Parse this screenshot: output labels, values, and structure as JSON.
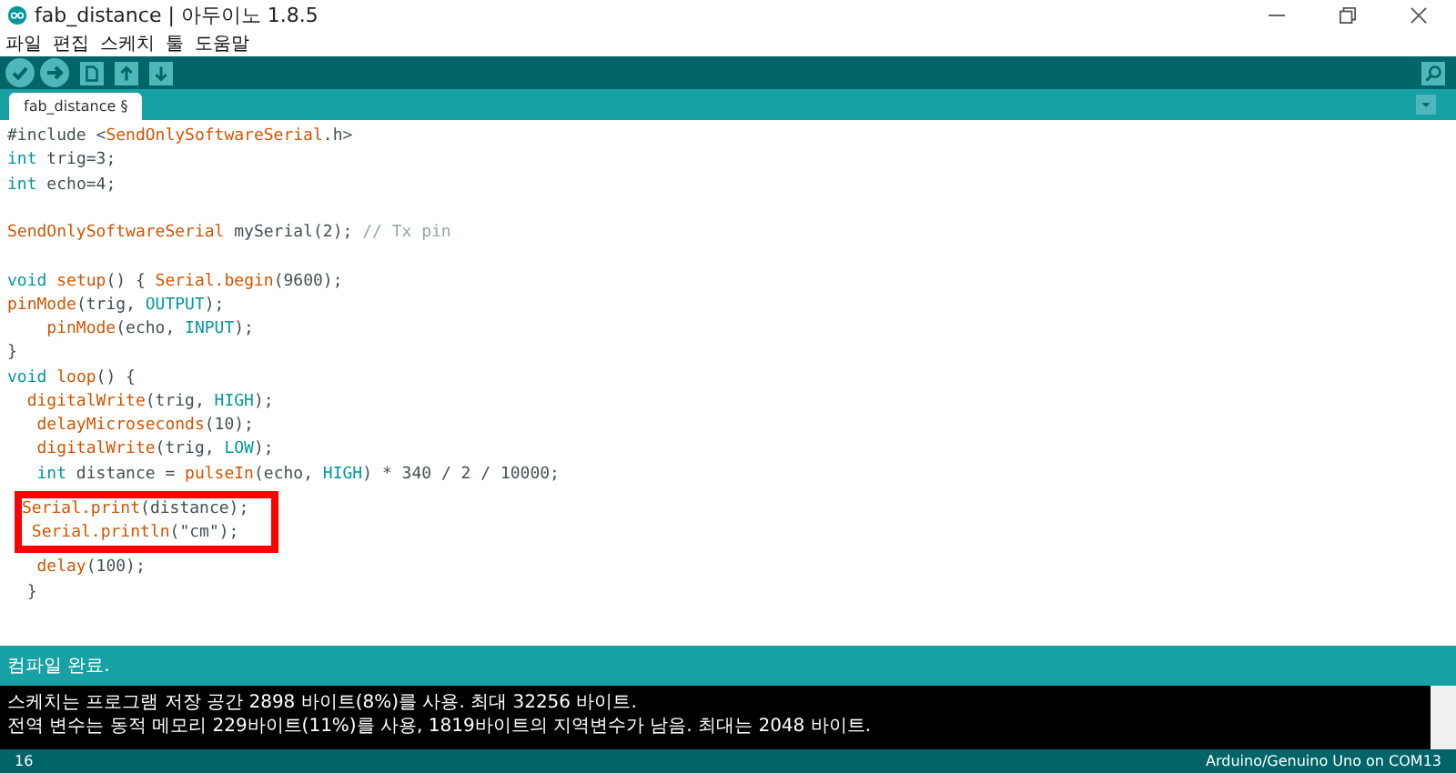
{
  "window": {
    "title": "fab_distance | 아두이노 1.8.5"
  },
  "menu": [
    "파일",
    "편집",
    "스케치",
    "툴",
    "도움말"
  ],
  "tabs": [
    {
      "label": "fab_distance §",
      "selected": true
    }
  ],
  "editor": {
    "lines": [
      {
        "kind": "code",
        "highlighted": false,
        "segments": [
          {
            "kind": "text",
            "s": "#include <"
          },
          {
            "kind": "fn",
            "s": "SendOnlySoftwareSerial"
          },
          {
            "kind": "text",
            "s": ".h>"
          }
        ]
      },
      {
        "kind": "code",
        "highlighted": false,
        "segments": [
          {
            "kind": "kw",
            "s": "int"
          },
          {
            "kind": "text",
            "s": " trig=3;"
          }
        ]
      },
      {
        "kind": "code",
        "highlighted": false,
        "segments": [
          {
            "kind": "kw",
            "s": "int"
          },
          {
            "kind": "text",
            "s": " echo=4;"
          }
        ]
      },
      {
        "kind": "blank"
      },
      {
        "kind": "code",
        "highlighted": false,
        "segments": [
          {
            "kind": "fn",
            "s": "SendOnlySoftwareSerial"
          },
          {
            "kind": "text",
            "s": " mySerial(2); "
          },
          {
            "kind": "comment",
            "s": "// Tx pin"
          }
        ]
      },
      {
        "kind": "blank"
      },
      {
        "kind": "code",
        "highlighted": false,
        "segments": [
          {
            "kind": "kw",
            "s": "void"
          },
          {
            "kind": "fn",
            "s": " setup"
          },
          {
            "kind": "text",
            "s": "() { "
          },
          {
            "kind": "fn",
            "s": "Serial.begin"
          },
          {
            "kind": "text",
            "s": "(9600);"
          }
        ]
      },
      {
        "kind": "code",
        "highlighted": false,
        "segments": [
          {
            "kind": "fn",
            "s": "pinMode"
          },
          {
            "kind": "text",
            "s": "(trig, "
          },
          {
            "kind": "kw",
            "s": "OUTPUT"
          },
          {
            "kind": "text",
            "s": ");"
          }
        ]
      },
      {
        "kind": "code",
        "highlighted": false,
        "segments": [
          {
            "kind": "fn",
            "s": "    pinMode"
          },
          {
            "kind": "text",
            "s": "(echo, "
          },
          {
            "kind": "kw",
            "s": "INPUT"
          },
          {
            "kind": "text",
            "s": ");"
          }
        ]
      },
      {
        "kind": "code",
        "highlighted": false,
        "segments": [
          {
            "kind": "text",
            "s": "}"
          }
        ]
      },
      {
        "kind": "code",
        "highlighted": false,
        "segments": [
          {
            "kind": "kw",
            "s": "void"
          },
          {
            "kind": "fn",
            "s": " loop"
          },
          {
            "kind": "text",
            "s": "() {"
          }
        ]
      },
      {
        "kind": "code",
        "highlighted": false,
        "segments": [
          {
            "kind": "fn",
            "s": "  digitalWrite"
          },
          {
            "kind": "text",
            "s": "(trig, "
          },
          {
            "kind": "kw",
            "s": "HIGH"
          },
          {
            "kind": "text",
            "s": ");"
          }
        ]
      },
      {
        "kind": "code",
        "highlighted": false,
        "segments": [
          {
            "kind": "fn",
            "s": "   delayMicroseconds"
          },
          {
            "kind": "text",
            "s": "(10);"
          }
        ]
      },
      {
        "kind": "code",
        "highlighted": false,
        "segments": [
          {
            "kind": "fn",
            "s": "   digitalWrite"
          },
          {
            "kind": "text",
            "s": "(trig, "
          },
          {
            "kind": "kw",
            "s": "LOW"
          },
          {
            "kind": "text",
            "s": ");"
          }
        ]
      },
      {
        "kind": "code",
        "highlighted": false,
        "segments": [
          {
            "kind": "kw",
            "s": "   int"
          },
          {
            "kind": "text",
            "s": " distance = "
          },
          {
            "kind": "fn",
            "s": "pulseIn"
          },
          {
            "kind": "text",
            "s": "(echo, "
          },
          {
            "kind": "kw",
            "s": "HIGH"
          },
          {
            "kind": "text",
            "s": ") * 340 / 2 / 10000;"
          }
        ]
      },
      {
        "kind": "code",
        "highlighted": true,
        "segments": [
          {
            "kind": "fn",
            "s": "Serial.print"
          },
          {
            "kind": "text",
            "s": "(distance);"
          }
        ]
      },
      {
        "kind": "code",
        "highlighted": true,
        "segments": [
          {
            "kind": "fn",
            "s": " Serial.println"
          },
          {
            "kind": "text",
            "s": "(\"cm\");"
          }
        ]
      },
      {
        "kind": "code",
        "highlighted": false,
        "segments": [
          {
            "kind": "fn",
            "s": "   delay"
          },
          {
            "kind": "text",
            "s": "(100);"
          }
        ]
      },
      {
        "kind": "code",
        "highlighted": false,
        "segments": [
          {
            "kind": "text",
            "s": "  }"
          }
        ]
      }
    ]
  },
  "status": "컴파일 완료.",
  "console": [
    "스케치는 프로그램 저장 공간 2898 바이트(8%)를 사용. 최대 32256 바이트.",
    "전역 변수는 동적 메모리 229바이트(11%)를 사용, 1819바이트의 지역변수가 남음.  최대는 2048 바이트."
  ],
  "status_bar": {
    "line": "16",
    "board": "Arduino/Genuino Uno on COM13"
  }
}
